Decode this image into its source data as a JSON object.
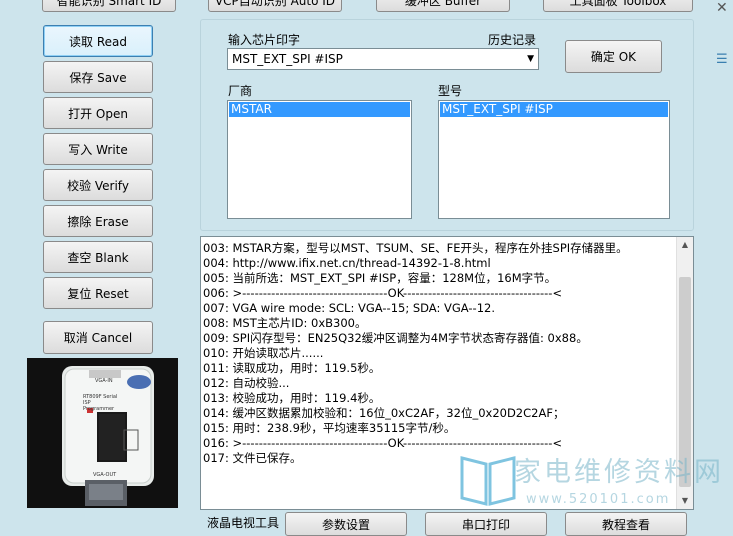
{
  "top_buttons": [
    "智能识别 Smart ID",
    "VCP自动识别 Auto ID",
    "缓冲区 Buffer",
    "工具面板 Toolbox"
  ],
  "left_buttons": {
    "read": "读取 Read",
    "save": "保存 Save",
    "open": "打开 Open",
    "write": "写入 Write",
    "verify": "校验 Verify",
    "erase": "擦除 Erase",
    "blank": "查空 Blank",
    "reset": "复位 Reset",
    "cancel": "取消 Cancel"
  },
  "chip_panel": {
    "input_label": "输入芯片印字",
    "history_label": "历史记录",
    "combo_value": "MST_EXT_SPI #ISP",
    "ok_button": "确定 OK",
    "vendor_label": "厂商",
    "vendor_items": [
      "MSTAR"
    ],
    "model_label": "型号",
    "model_items": [
      "MST_EXT_SPI #ISP"
    ]
  },
  "log_lines": [
    "003:  MSTAR方案，型号以MST、TSUM、SE、FE开头，程序在外挂SPI存储器里。",
    "004:  http://www.ifix.net.cn/thread-14392-1-8.html",
    "005:  当前所选：MST_EXT_SPI #ISP，容量：128M位，16M字节。",
    "006:  >-----------------------------------OK------------------------------------<",
    "007:  VGA wire mode: SCL: VGA--15; SDA: VGA--12.",
    "008:  MST主芯片ID: 0xB300。",
    "009:  SPI闪存型号：EN25Q32缓冲区调整为4M字节状态寄存器值: 0x88。",
    "010:  开始读取芯片......",
    "011:  读取成功，用时：119.5秒。",
    "012:  自动校验...",
    "013:  校验成功，用时：119.4秒。",
    "014:  缓冲区数据累加校验和：16位_0xC2AF，32位_0x20D2C2AF；",
    "015:  用时：238.9秒，平均速率35115字节/秒。",
    "016:  >-----------------------------------OK------------------------------------<",
    "017:  文件已保存。"
  ],
  "bottom": {
    "label": "液晶电视工具",
    "params_button": "参数设置",
    "serial_print_button": "串口打印",
    "tutorial_button": "教程查看"
  },
  "device_image": {
    "caption_top": "VGA-IN",
    "caption_mid": "RT809F Serial ISP Programmer",
    "caption_bottom": "VGA-OUT"
  },
  "watermark": {
    "text": "家电维修资料网",
    "url": "www.520101.com"
  },
  "window": {
    "close_glyph": "✕",
    "menu_glyph": "☰"
  }
}
